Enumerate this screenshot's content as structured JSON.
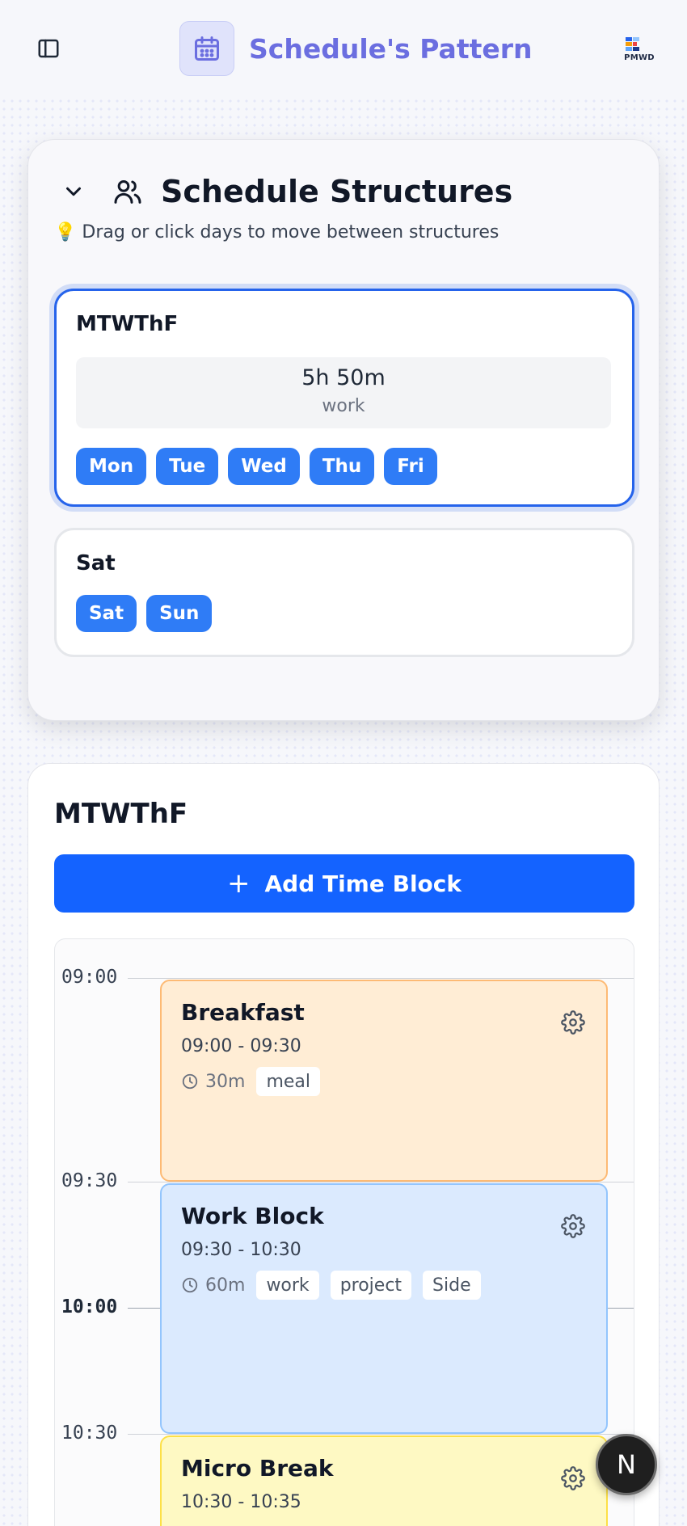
{
  "header": {
    "app_title": "Schedule's Pattern",
    "logo_text": "PMWD",
    "sidebar_icon": "sidebar-panel-icon",
    "brand_icon": "calendar-icon"
  },
  "structures_panel": {
    "title": "Schedule Structures",
    "hint_emoji": "💡",
    "hint": "Drag or click days to move between structures",
    "structures": [
      {
        "name": "MTWThF",
        "selected": true,
        "summary_value": "5h 50m",
        "summary_label": "work",
        "days": [
          "Mon",
          "Tue",
          "Wed",
          "Thu",
          "Fri"
        ]
      },
      {
        "name": "Sat",
        "selected": false,
        "days": [
          "Sat",
          "Sun"
        ]
      }
    ]
  },
  "editor": {
    "title": "MTWThF",
    "add_button_label": "Add Time Block",
    "time_labels": [
      "09:00",
      "09:30",
      "10:00",
      "10:30"
    ],
    "blocks": [
      {
        "title": "Breakfast",
        "time": "09:00 - 09:30",
        "duration": "30m",
        "tags": [
          "meal"
        ],
        "color": "#ffedd5"
      },
      {
        "title": "Work Block",
        "time": "09:30 - 10:30",
        "duration": "60m",
        "tags": [
          "work",
          "project",
          "Side"
        ],
        "color": "#dbeafe"
      },
      {
        "title": "Micro Break",
        "time": "10:30 - 10:35",
        "color": "#fef9c3"
      }
    ]
  },
  "fab": {
    "label": "N"
  },
  "colors": {
    "accent": "#1463ff",
    "brand": "#6b6ee0",
    "chip": "#2f7cf6"
  }
}
